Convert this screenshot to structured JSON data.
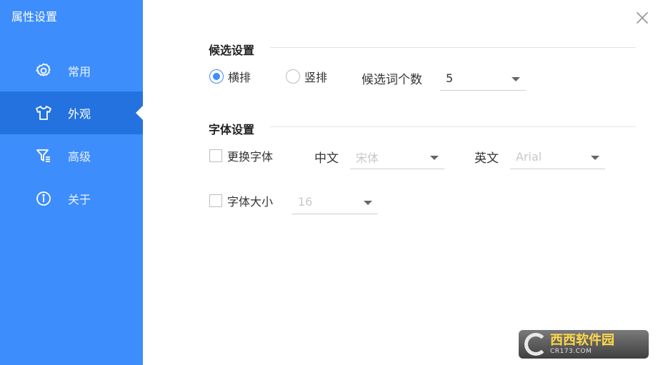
{
  "window": {
    "title": "属性设置"
  },
  "sidebar": {
    "items": [
      {
        "label": "常用",
        "icon": "gear-icon",
        "active": false
      },
      {
        "label": "外观",
        "icon": "tshirt-icon",
        "active": true
      },
      {
        "label": "高级",
        "icon": "filter-icon",
        "active": false
      },
      {
        "label": "关于",
        "icon": "info-icon",
        "active": false
      }
    ]
  },
  "candidate": {
    "section_title": "候选设置",
    "horizontal_label": "横排",
    "vertical_label": "竖排",
    "selected": "横排",
    "count_label": "候选词个数",
    "count_value": "5"
  },
  "font": {
    "section_title": "字体设置",
    "change_font_label": "更换字体",
    "chinese_label": "中文",
    "chinese_value": "宋体",
    "english_label": "英文",
    "english_value": "Arial",
    "size_label": "字体大小",
    "size_value": "16"
  },
  "watermark": {
    "main": "西西软件园",
    "sub": "CR173.COM"
  },
  "colors": {
    "accent": "#3d8dfc",
    "active_nav": "#2472df"
  }
}
